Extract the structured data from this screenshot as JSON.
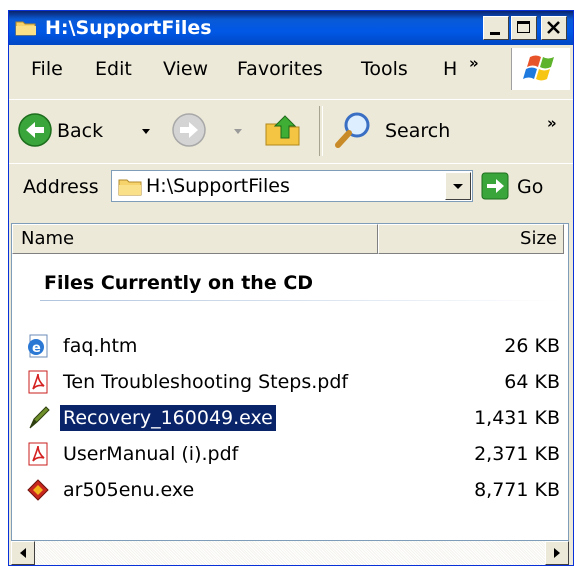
{
  "window": {
    "title": "H:\\SupportFiles"
  },
  "menu": {
    "items": [
      "File",
      "Edit",
      "View",
      "Favorites",
      "Tools",
      "H"
    ],
    "overflow": "»"
  },
  "toolbar": {
    "back_label": "Back",
    "search_label": "Search",
    "overflow": "»"
  },
  "address": {
    "label": "Address",
    "value": "H:\\SupportFiles",
    "go_label": "Go"
  },
  "list": {
    "columns": {
      "name": "Name",
      "size": "Size"
    },
    "group_title": "Files Currently on the CD",
    "files": [
      {
        "name": "faq.htm",
        "size": "26 KB",
        "icon": "html-document-icon"
      },
      {
        "name": "Ten Troubleshooting Steps.pdf",
        "size": "64 KB",
        "icon": "pdf-icon"
      },
      {
        "name": "Recovery_160049.exe",
        "size": "1,431 KB",
        "icon": "executable-pen-icon",
        "selected": true
      },
      {
        "name": "UserManual (i).pdf",
        "size": "2,371 KB",
        "icon": "pdf-icon"
      },
      {
        "name": "ar505enu.exe",
        "size": "8,771 KB",
        "icon": "installer-icon"
      }
    ]
  },
  "colors": {
    "title_bar": "#0058e6",
    "selection": "#0a246a",
    "chrome": "#ece9d8"
  }
}
